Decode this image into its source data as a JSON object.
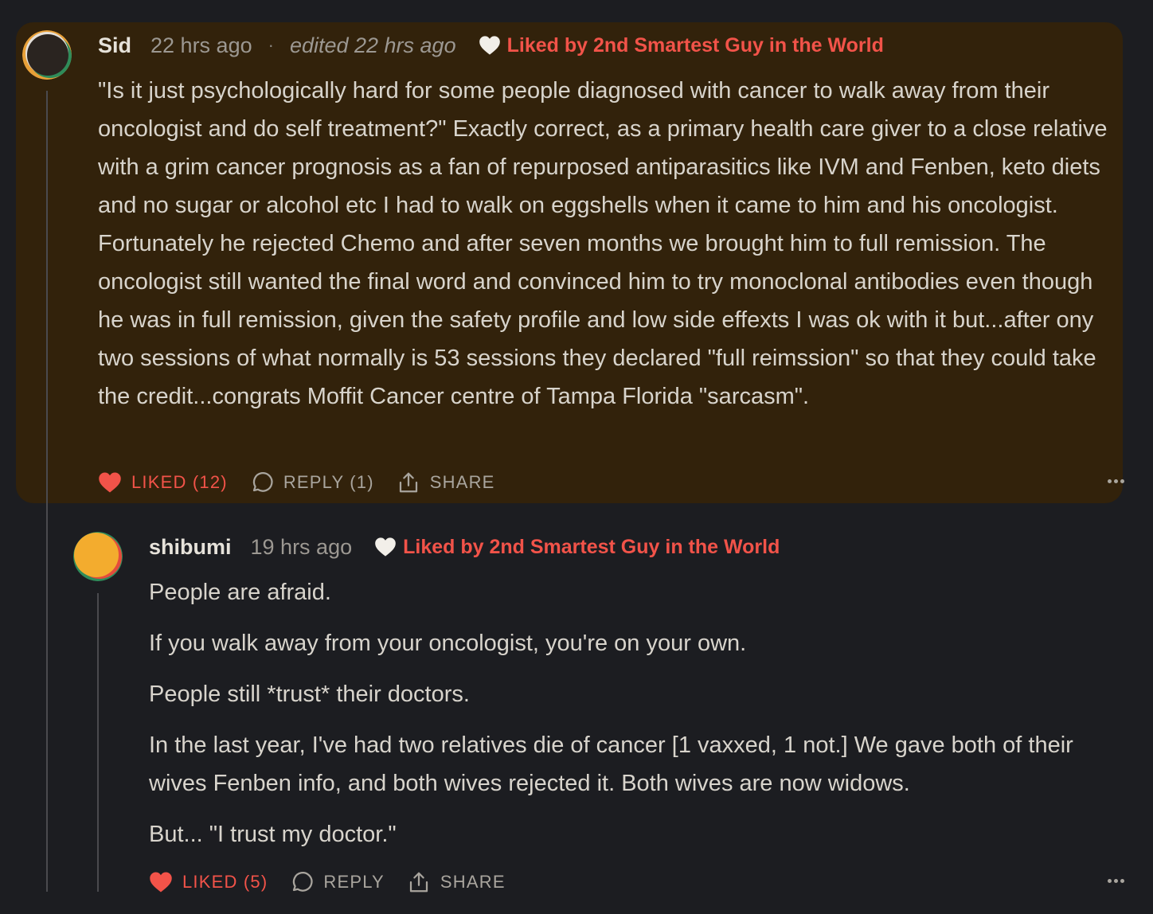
{
  "comment1": {
    "author": "Sid",
    "time": "22 hrs ago",
    "separator": "·",
    "edited": "edited 22 hrs ago",
    "liked_by": "Liked by 2nd Smartest Guy in the World",
    "body": "\"Is it just psychologically hard for some people diagnosed with cancer to walk away from their oncologist and do self treatment?\" Exactly correct, as a primary health care giver to a close relative with a grim cancer prognosis as a fan of repurposed antiparasitics like IVM and Fenben, keto diets and no sugar or alcohol etc I had to walk on eggshells when it came to him and his oncologist. Fortunately he rejected Chemo and after seven months we brought him to full remission. The oncologist still wanted the final word and convinced him to try monoclonal antibodies even though he was in full remission, given the safety profile and low side effexts I was ok with it but...after ony two sessions of what normally is 53 sessions they declared \"full reimssion\" so that they could take the credit...congrats Moffit Cancer centre of Tampa Florida \"sarcasm\".",
    "like_label": "LIKED (12)",
    "reply_label": "REPLY (1)",
    "share_label": "SHARE"
  },
  "comment2": {
    "author": "shibumi",
    "time": "19 hrs ago",
    "liked_by": "Liked by 2nd Smartest Guy in the World",
    "paragraphs": [
      "People are afraid.",
      "If you walk away from your oncologist, you're on your own.",
      "People still *trust* their doctors.",
      "In the last year, I've had two relatives die of cancer [1 vaxxed, 1 not.] We gave both of their wives Fenben info, and both wives rejected it. Both wives are now widows.",
      "But... \"I trust my doctor.\""
    ],
    "like_label": "LIKED (5)",
    "reply_label": "REPLY",
    "share_label": "SHARE"
  },
  "colors": {
    "background": "#1c1d21",
    "highlight": "#32220b",
    "accent": "#f25349",
    "text": "#d8d4cc",
    "muted": "#9c9892"
  },
  "icons": [
    "heart-icon",
    "comment-bubble-icon",
    "share-icon",
    "more-options-icon"
  ]
}
